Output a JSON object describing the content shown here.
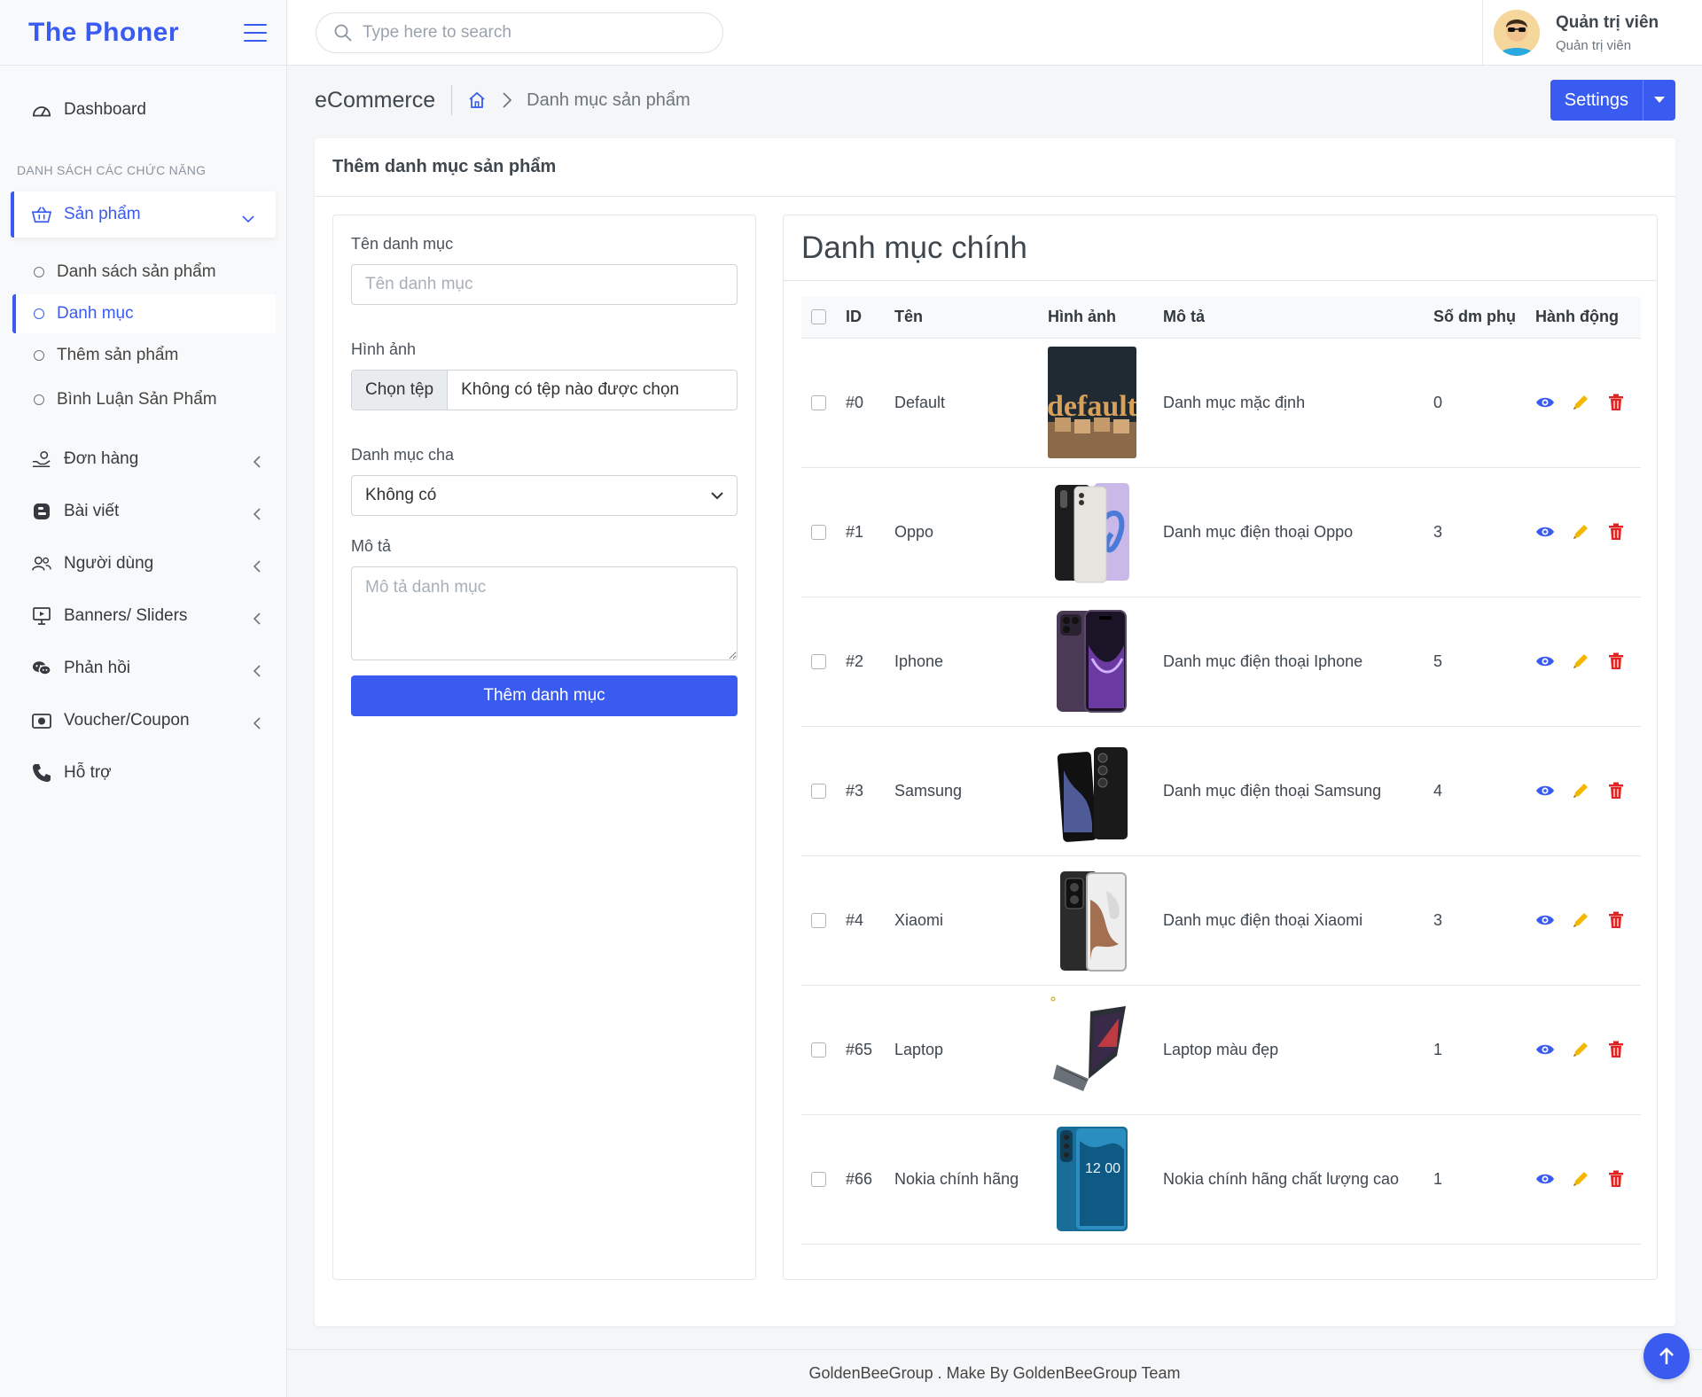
{
  "brand": {
    "title": "The Phoner"
  },
  "search": {
    "placeholder": "Type here to search"
  },
  "user": {
    "name": "Quản trị viên",
    "role": "Quản trị viên"
  },
  "sidebar": {
    "dashboard": "Dashboard",
    "section_label": "DANH SÁCH CÁC CHỨC NĂNG",
    "products": "Sản phẩm",
    "sub_items": [
      "Danh sách sản phẩm",
      "Danh mục",
      "Thêm sản phẩm",
      "Bình Luận Sản Phẩm"
    ],
    "items": [
      "Đơn hàng",
      "Bài viết",
      "Người dùng",
      "Banners/ Sliders",
      "Phản hồi",
      "Voucher/Coupon"
    ],
    "support": "Hỗ trợ"
  },
  "header": {
    "page_title": "eCommerce",
    "breadcrumb_current": "Danh mục sản phẩm",
    "settings_label": "Settings"
  },
  "card": {
    "title": "Thêm danh mục sản phẩm"
  },
  "form": {
    "name_label": "Tên danh mục",
    "name_placeholder": "Tên danh mục",
    "image_label": "Hình ảnh",
    "file_button": "Chọn tệp",
    "file_none": "Không có tệp nào được chọn",
    "parent_label": "Danh mục cha",
    "parent_selected": "Không có",
    "desc_label": "Mô tả",
    "desc_placeholder": "Mô tả danh mục",
    "submit_label": "Thêm danh mục"
  },
  "table": {
    "title": "Danh mục chính",
    "headers": {
      "id": "ID",
      "name": "Tên",
      "image": "Hình ảnh",
      "desc": "Mô tả",
      "sub_count": "Số dm phụ",
      "actions": "Hành động"
    },
    "rows": [
      {
        "id": "#0",
        "name": "Default",
        "desc": "Danh mục mặc định",
        "sub_count": "0",
        "image_text": "default"
      },
      {
        "id": "#1",
        "name": "Oppo",
        "desc": "Danh mục điện thoại Oppo",
        "sub_count": "3"
      },
      {
        "id": "#2",
        "name": "Iphone",
        "desc": "Danh mục điện thoại Iphone",
        "sub_count": "5"
      },
      {
        "id": "#3",
        "name": "Samsung",
        "desc": "Danh mục điện thoại Samsung",
        "sub_count": "4"
      },
      {
        "id": "#4",
        "name": "Xiaomi",
        "desc": "Danh mục điện thoại Xiaomi",
        "sub_count": "3"
      },
      {
        "id": "#65",
        "name": "Laptop",
        "desc": "Laptop màu đẹp",
        "sub_count": "1"
      },
      {
        "id": "#66",
        "name": "Nokia chính hãng",
        "desc": "Nokia chính hãng chất lượng cao",
        "sub_count": "1",
        "image_text": "12 00"
      }
    ]
  },
  "footer": {
    "text": "GoldenBeeGroup . Make By GoldenBeeGroup Team"
  },
  "colors": {
    "primary": "#3a5bf0",
    "edit": "#f5b800",
    "delete": "#e02424",
    "view": "#3a5bf0"
  }
}
